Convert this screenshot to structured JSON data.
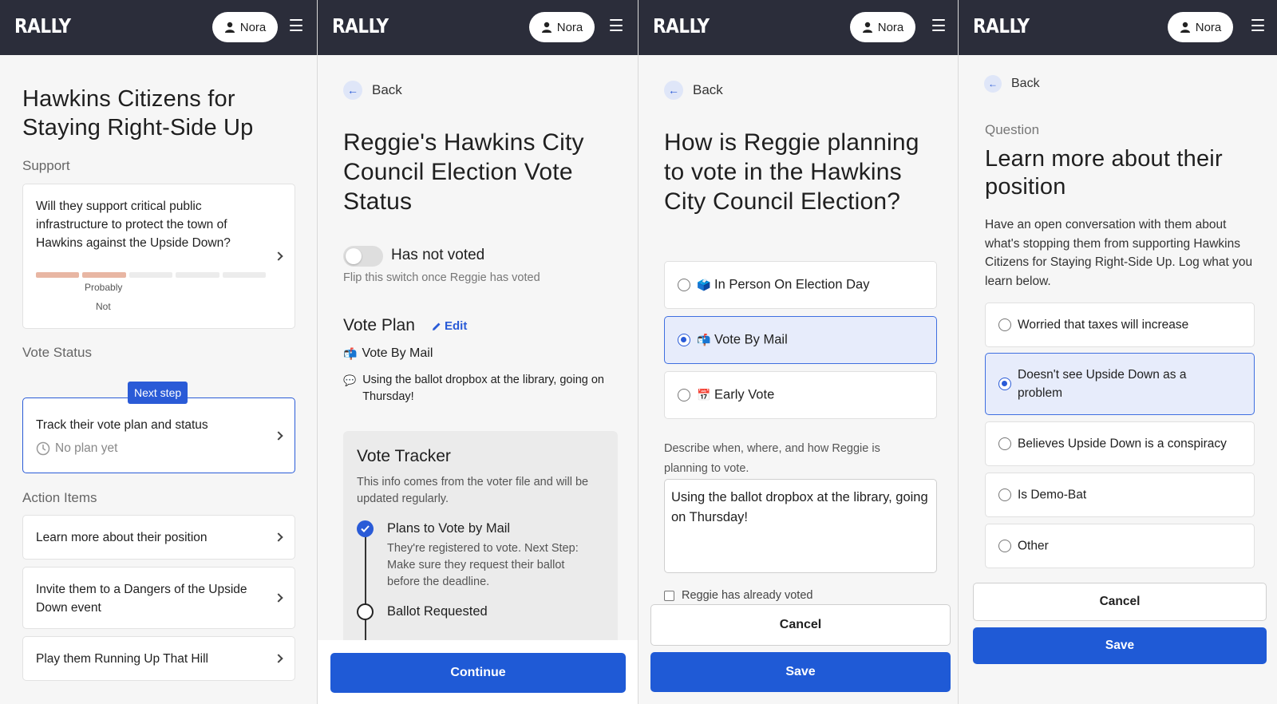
{
  "app": {
    "logo": "RALLY",
    "user": "Nora"
  },
  "screen1": {
    "title": "Hawkins Citizens for Staying Right-Side Up",
    "support_heading": "Support",
    "support_question": "Will they support critical public infrastructure to protect the town of Hawkins against the Upside Down?",
    "support_level_label_line1": "Probably",
    "support_level_label_line2": "Not",
    "support_level": "2 of 5",
    "vote_status_heading": "Vote Status",
    "next_step_badge": "Next step",
    "vote_card_title": "Track their vote plan and status",
    "vote_card_status": "No plan yet",
    "action_items_heading": "Action Items",
    "action_items": [
      {
        "label": "Learn more about their position"
      },
      {
        "label": "Invite them to a Dangers of the Upside Down event"
      },
      {
        "label": "Play them Running Up That Hill"
      }
    ]
  },
  "screen2": {
    "back": "Back",
    "title": "Reggie's Hawkins City Council Election Vote Status",
    "toggle_label": "Has not voted",
    "toggle_hint": "Flip this switch once Reggie has voted",
    "vote_plan_heading": "Vote Plan",
    "edit_label": "Edit",
    "plan_method": "Vote By Mail",
    "plan_note": "Using the ballot dropbox at the library, going on Thursday!",
    "tracker_title": "Vote Tracker",
    "tracker_desc": "This info comes from the voter file and will be updated regularly.",
    "tracker_steps": [
      {
        "title": "Plans to Vote by Mail",
        "desc": "They're registered to vote. Next Step: Make sure they request their ballot before the deadline.",
        "done": true
      },
      {
        "title": "Ballot Requested",
        "desc": "",
        "done": false
      }
    ],
    "continue": "Continue"
  },
  "screen3": {
    "back": "Back",
    "title": "How is Reggie planning to vote in the Hawkins City Council Election?",
    "options": [
      {
        "label": "In Person On Election Day",
        "emoji": "🗳️",
        "selected": false
      },
      {
        "label": "Vote By Mail",
        "emoji": "📬",
        "selected": true
      },
      {
        "label": "Early Vote",
        "emoji": "📅",
        "selected": false
      }
    ],
    "describe_label": "Describe when, where, and how Reggie is planning to vote.",
    "describe_value": "Using the ballot dropbox at the library, going on Thursday!",
    "already_voted_label": "Reggie has already voted",
    "cancel": "Cancel",
    "save": "Save"
  },
  "screen4": {
    "back": "Back",
    "eyebrow": "Question",
    "title": "Learn more about their position",
    "description": "Have an open conversation with them about what's stopping them from supporting Hawkins Citizens for Staying Right-Side Up. Log what you learn below.",
    "options": [
      {
        "label": "Worried that taxes will increase",
        "selected": false
      },
      {
        "label": "Doesn't see Upside Down as a problem",
        "selected": true
      },
      {
        "label": "Believes Upside Down is a conspiracy",
        "selected": false
      },
      {
        "label": "Is Demo-Bat",
        "selected": false
      },
      {
        "label": "Other",
        "selected": false
      }
    ],
    "cancel": "Cancel",
    "save": "Save"
  },
  "colors": {
    "topbar": "#2b2d3a",
    "accent": "#1f5ad6",
    "selected_bg": "#e7ecfb",
    "support_bar": "#e8b6a3"
  }
}
